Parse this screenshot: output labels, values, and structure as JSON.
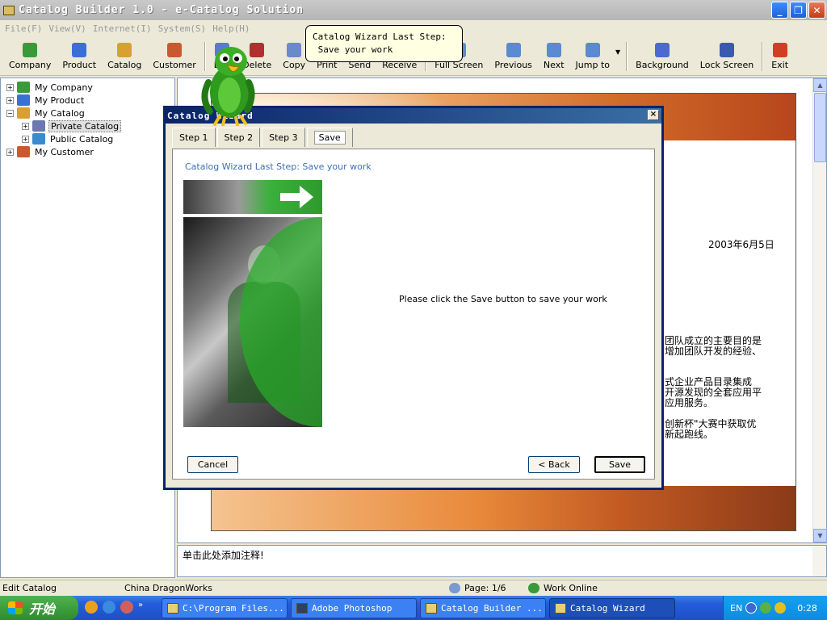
{
  "window": {
    "title": "Catalog Builder 1.0 - e-Catalog Solution"
  },
  "menu": [
    "File(F)",
    "View(V)",
    "Internet(I)",
    "System(S)",
    "Help(H)"
  ],
  "toolbar": {
    "items": [
      {
        "label": "Company",
        "icon": "globe-icon",
        "color": "#3a9a3a"
      },
      {
        "label": "Product",
        "icon": "product-icon",
        "color": "#3b6fd6"
      },
      {
        "label": "Catalog",
        "icon": "catalog-icon",
        "color": "#d8a030"
      },
      {
        "label": "Customer",
        "icon": "customer-icon",
        "color": "#c85a30"
      },
      {
        "label": "Edit",
        "icon": "edit-icon",
        "color": "#5a7ad0"
      },
      {
        "label": "Delete",
        "icon": "delete-icon",
        "color": "#b03030"
      },
      {
        "label": "Copy",
        "icon": "copy-icon",
        "color": "#6a8acc"
      },
      {
        "label": "Print",
        "icon": "print-icon",
        "color": "#808080"
      },
      {
        "label": "Send",
        "icon": "send-icon",
        "color": "#4a8ad0"
      },
      {
        "label": "Receive",
        "icon": "receive-icon",
        "color": "#4a8ad0"
      },
      {
        "label": "Full Screen",
        "icon": "fullscreen-icon",
        "color": "#5a8ad0"
      },
      {
        "label": "Previous",
        "icon": "previous-icon",
        "color": "#5a8ad0"
      },
      {
        "label": "Next",
        "icon": "next-icon",
        "color": "#5a8ad0"
      },
      {
        "label": "Jump to",
        "icon": "jump-icon",
        "color": "#5a8ad0"
      },
      {
        "label": "Background",
        "icon": "background-icon",
        "color": "#4a6ad0"
      },
      {
        "label": "Lock Screen",
        "icon": "lock-icon",
        "color": "#3a5ab0"
      },
      {
        "label": "Exit",
        "icon": "exit-icon",
        "color": "#d04020"
      }
    ]
  },
  "tree": {
    "nodes": [
      {
        "label": "My Company",
        "expander": "+",
        "icon": "globe-icon",
        "color": "#3a9a3a"
      },
      {
        "label": "My Product",
        "expander": "+",
        "icon": "product-icon",
        "color": "#3b6fd6"
      },
      {
        "label": "My Catalog",
        "expander": "−",
        "icon": "catalog-icon",
        "color": "#d8a030"
      },
      {
        "label": "Private Catalog",
        "expander": "+",
        "icon": "private-catalog-icon",
        "color": "#6a7ab0"
      },
      {
        "label": "Public Catalog",
        "expander": "+",
        "icon": "public-catalog-icon",
        "color": "#3a8ad0"
      },
      {
        "label": "My Customer",
        "expander": "+",
        "icon": "customer-icon",
        "color": "#c85a30"
      }
    ],
    "selected": "Private Catalog"
  },
  "document": {
    "date": "2003年6月5日",
    "paragraphs": [
      "团队成立的主要目的是\n增加团队开发的经验、",
      "式企业产品目录集成\n开源发现的全套应用平\n应用服务。",
      "创新杯\"大赛中获取优\n新起跑线。"
    ]
  },
  "note": {
    "text": "单击此处添加注释!"
  },
  "status": {
    "mode": "Edit Catalog",
    "company": "China DragonWorks",
    "page": "Page: 1/6",
    "connection": "Work Online"
  },
  "taskbar": {
    "start_label": "开始",
    "tasks": [
      {
        "label": "C:\\Program Files..."
      },
      {
        "label": "Adobe Photoshop"
      },
      {
        "label": "Catalog Builder ..."
      },
      {
        "label": "Catalog Wizard"
      }
    ],
    "tray_lang": "EN",
    "clock": "0:28"
  },
  "wizard": {
    "title": "Catalog Wizard",
    "tabs": [
      "Step 1",
      "Step 2",
      "Step 3",
      "Save"
    ],
    "heading": "Catalog Wizard Last Step: Save your work",
    "message": "Please click the Save button to save your work",
    "cancel_label": "Cancel",
    "back_label": "< Back",
    "save_label": "Save"
  },
  "assistant": {
    "balloon_text": "Catalog Wizard Last Step:\n Save your work"
  }
}
